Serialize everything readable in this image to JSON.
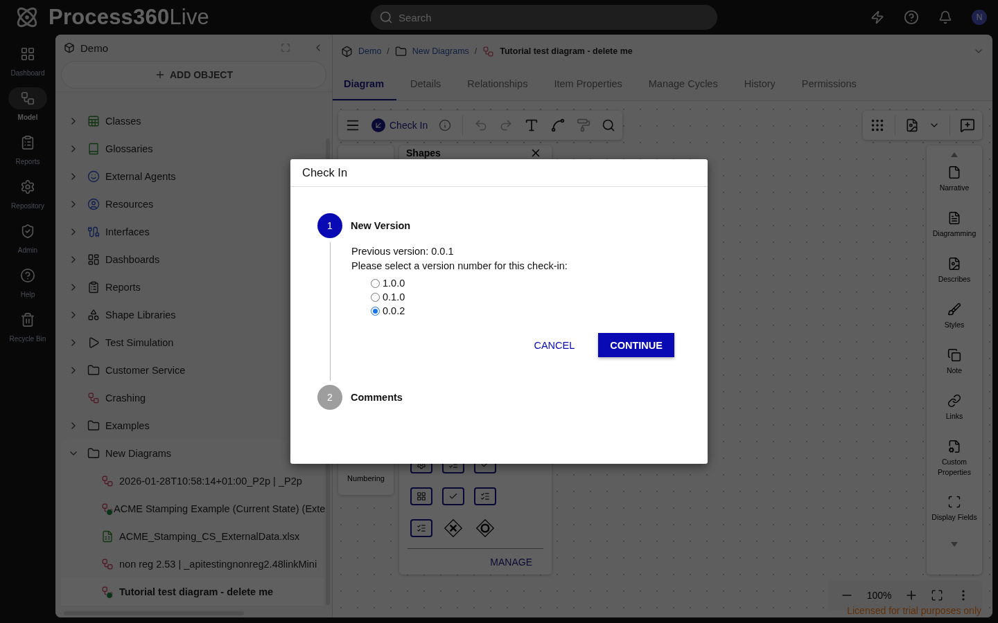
{
  "app": {
    "logo": "**Process360**Live",
    "search_placeholder": "Search",
    "avatar": "N"
  },
  "nav": [
    {
      "label": "Dashboard",
      "kind": "dashboard",
      "selected": false
    },
    {
      "label": "Model",
      "kind": "model",
      "selected": true
    },
    {
      "label": "Reports",
      "kind": "reports",
      "selected": false
    },
    {
      "label": "Repository",
      "kind": "repository",
      "selected": false
    },
    {
      "label": "Admin",
      "kind": "admin",
      "selected": false
    },
    {
      "label": "Help",
      "kind": "help",
      "selected": false
    },
    {
      "label": "Recycle Bin",
      "kind": "bin",
      "selected": false
    }
  ],
  "explorer": {
    "title": "Demo",
    "add_button": "ADD OBJECT",
    "tree": [
      {
        "label": "Classes",
        "kind": "classes",
        "expanded": false
      },
      {
        "label": "Glossaries",
        "kind": "glossary",
        "expanded": false
      },
      {
        "label": "External Agents",
        "kind": "agents",
        "expanded": false
      },
      {
        "label": "Resources",
        "kind": "resources",
        "expanded": false
      },
      {
        "label": "Interfaces",
        "kind": "interfaces",
        "expanded": false
      },
      {
        "label": "Dashboards",
        "kind": "dashboards",
        "expanded": false
      },
      {
        "label": "Reports",
        "kind": "reports",
        "expanded": false
      },
      {
        "label": "Shape Libraries",
        "kind": "shapes",
        "expanded": false
      },
      {
        "label": "Test Simulation",
        "kind": "simulation",
        "expanded": false
      },
      {
        "label": "Customer Service",
        "kind": "folder",
        "expanded": false
      },
      {
        "label": "Crashing",
        "kind": "diagram"
      },
      {
        "label": "Examples",
        "kind": "folder",
        "expanded": false
      },
      {
        "label": "New Diagrams",
        "kind": "folder",
        "expanded": true,
        "children": [
          {
            "label": "2026-01-28T10:58:14+01:00_P2p | _P2p",
            "kind": "diagram",
            "status_badge": false,
            "selected": false
          },
          {
            "label": "ACME Stamping Example (Current State) (Exte",
            "kind": "diagram",
            "status_badge": true,
            "selected": false
          },
          {
            "label": "ACME_Stamping_CS_ExternalData.xlsx",
            "kind": "spreadsheet",
            "status_badge": false,
            "selected": false
          },
          {
            "label": "non reg 2.53 | _apitestingnonreg2.48linkMini",
            "kind": "diagram",
            "status_badge": false,
            "selected": false
          },
          {
            "label": "Tutorial test diagram - delete me",
            "kind": "diagram",
            "status_badge": true,
            "selected": true
          }
        ]
      }
    ]
  },
  "breadcrumb": {
    "separator": "/",
    "items": [
      {
        "label": "Demo",
        "kind": "project"
      },
      {
        "label": "New Diagrams",
        "kind": "folder"
      },
      {
        "label": "Tutorial test diagram - delete me",
        "kind": "diagram"
      }
    ]
  },
  "tabs": [
    {
      "label": "Diagram",
      "selected": true
    },
    {
      "label": "Details",
      "selected": false
    },
    {
      "label": "Relationships",
      "selected": false
    },
    {
      "label": "Item Properties",
      "selected": false
    },
    {
      "label": "Manage Cycles",
      "selected": false
    },
    {
      "label": "History",
      "selected": false
    },
    {
      "label": "Permissions",
      "selected": false
    }
  ],
  "toolbar": {
    "check_in": "Check In"
  },
  "numbering": {
    "label": "Numbering"
  },
  "shapes": {
    "title": "Shapes",
    "manage": "MANAGE"
  },
  "right_panel": [
    {
      "label": "Narrative",
      "kind": "narrative"
    },
    {
      "label": "Diagramming",
      "kind": "diagramming"
    },
    {
      "label": "Describes",
      "kind": "describes"
    },
    {
      "label": "Styles",
      "kind": "styles"
    },
    {
      "label": "Note",
      "kind": "note"
    },
    {
      "label": "Links",
      "kind": "links"
    },
    {
      "label": "Custom Properties",
      "kind": "custom"
    },
    {
      "label": "Display Fields",
      "kind": "fields"
    }
  ],
  "zoom": {
    "value": "100%"
  },
  "license": "Licensed for trial purposes only",
  "dialog": {
    "title": "Check In",
    "steps": [
      {
        "number": "1",
        "title": "New Version",
        "active": true,
        "previous": "Previous version: 0.0.1",
        "prompt": "Please select a version number for this check-in:",
        "options": [
          {
            "label": "1.0.0",
            "selected": false
          },
          {
            "label": "0.1.0",
            "selected": false
          },
          {
            "label": "0.0.2",
            "selected": true
          }
        ],
        "cancel": "CANCEL",
        "continue": "CONTINUE"
      },
      {
        "number": "2",
        "title": "Comments",
        "active": false
      }
    ]
  }
}
